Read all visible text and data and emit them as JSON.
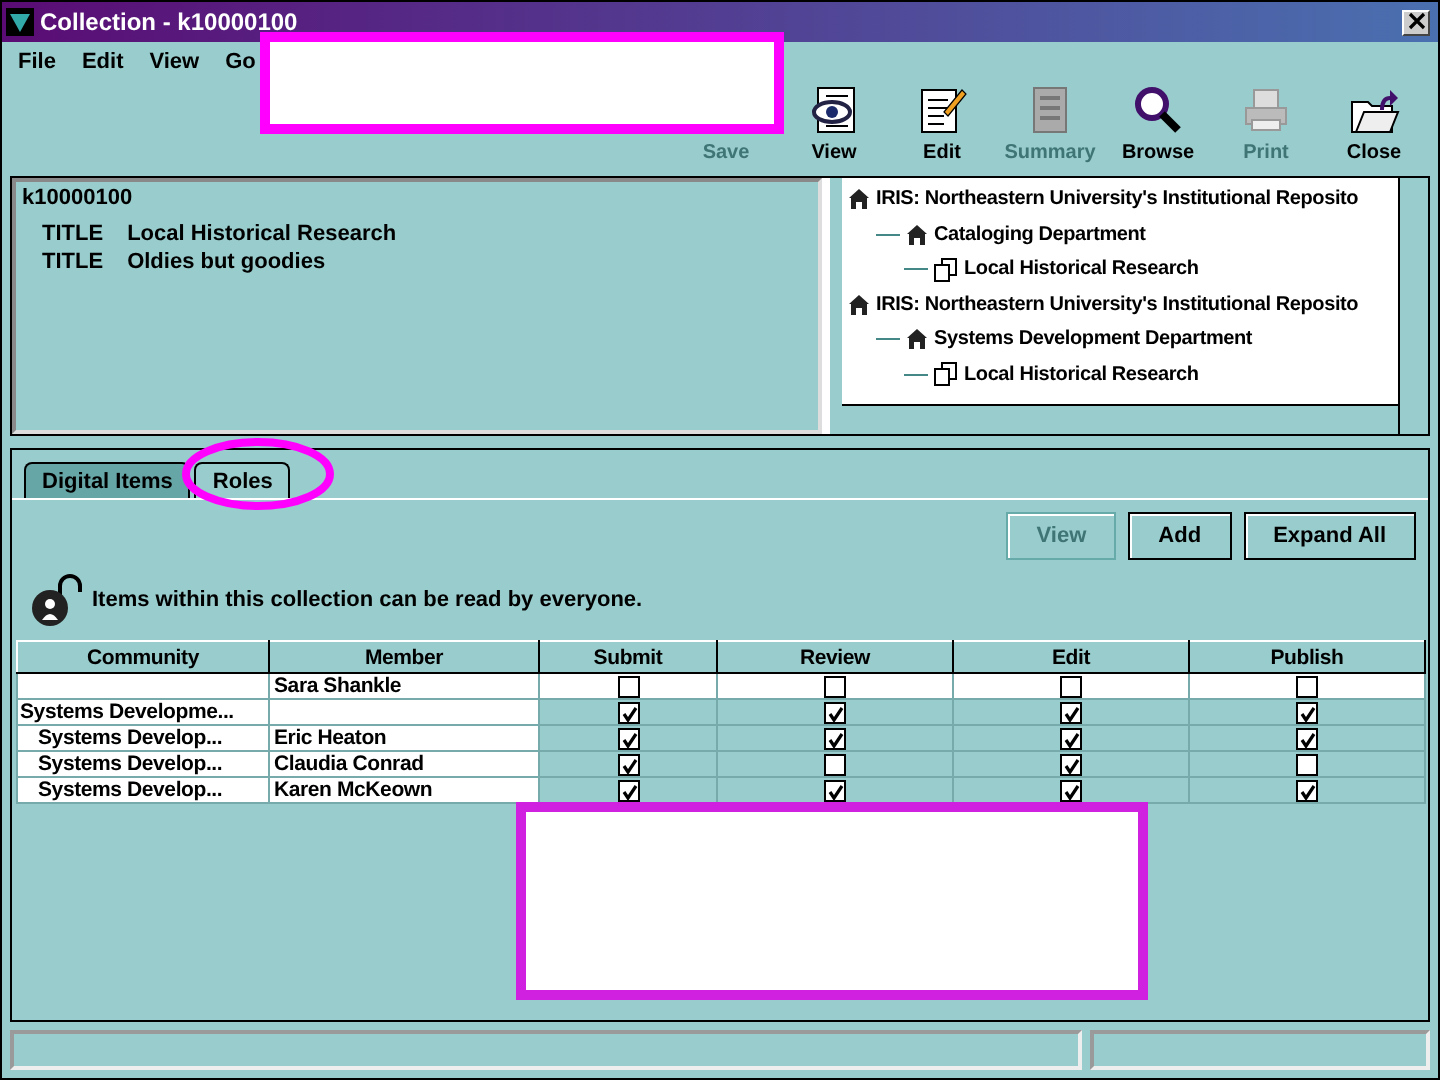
{
  "window": {
    "title": "Collection - k10000100"
  },
  "menu": [
    "File",
    "Edit",
    "View",
    "Go"
  ],
  "toolbar": [
    {
      "label": "Save",
      "kind": "save",
      "disabled": true
    },
    {
      "label": "View",
      "kind": "view",
      "disabled": false
    },
    {
      "label": "Edit",
      "kind": "edit",
      "disabled": false
    },
    {
      "label": "Summary",
      "kind": "summary",
      "disabled": true
    },
    {
      "label": "Browse",
      "kind": "browse",
      "disabled": false
    },
    {
      "label": "Print",
      "kind": "print",
      "disabled": true
    },
    {
      "label": "Close",
      "kind": "close",
      "disabled": false
    }
  ],
  "detail": {
    "id": "k10000100",
    "fields": [
      {
        "label": "TITLE",
        "value": "Local Historical Research"
      },
      {
        "label": "TITLE",
        "value": "Oldies but goodies"
      }
    ]
  },
  "tree": {
    "items": [
      {
        "label": "IRIS: Northeastern University's Institutional Reposito",
        "kind": "community",
        "children": [
          {
            "label": "Cataloging Department",
            "kind": "community",
            "children": [
              {
                "label": "Local Historical Research",
                "kind": "collection"
              }
            ]
          }
        ]
      },
      {
        "label": "IRIS: Northeastern University's Institutional Reposito",
        "kind": "community",
        "children": [
          {
            "label": "Systems Development Department",
            "kind": "community",
            "children": [
              {
                "label": "Local Historical Research",
                "kind": "collection"
              }
            ]
          }
        ]
      }
    ]
  },
  "tabs": [
    {
      "label": "Digital Items",
      "selected": false
    },
    {
      "label": "Roles",
      "selected": true
    }
  ],
  "actions": [
    {
      "label": "View",
      "disabled": true
    },
    {
      "label": "Add",
      "disabled": false
    },
    {
      "label": "Expand All",
      "disabled": false
    }
  ],
  "notice": "Items within this collection can be read by everyone.",
  "roles_table": {
    "columns": [
      "Community",
      "Member",
      "Submit",
      "Review",
      "Edit",
      "Publish"
    ],
    "rows": [
      {
        "member": "Sara Shankle",
        "submit": false,
        "review": false,
        "edit": false,
        "publish": false
      },
      {
        "community": "Systems Developme...",
        "submit": true,
        "review": true,
        "edit": true,
        "publish": true,
        "children": [
          {
            "community": "Systems Develop...",
            "member": "Eric Heaton",
            "submit": true,
            "review": true,
            "edit": true,
            "publish": true
          },
          {
            "community": "Systems Develop...",
            "member": "Claudia Conrad",
            "submit": true,
            "review": false,
            "edit": true,
            "publish": false
          },
          {
            "community": "Systems Develop...",
            "member": "Karen McKeown",
            "submit": true,
            "review": true,
            "edit": true,
            "publish": true
          }
        ]
      }
    ]
  }
}
